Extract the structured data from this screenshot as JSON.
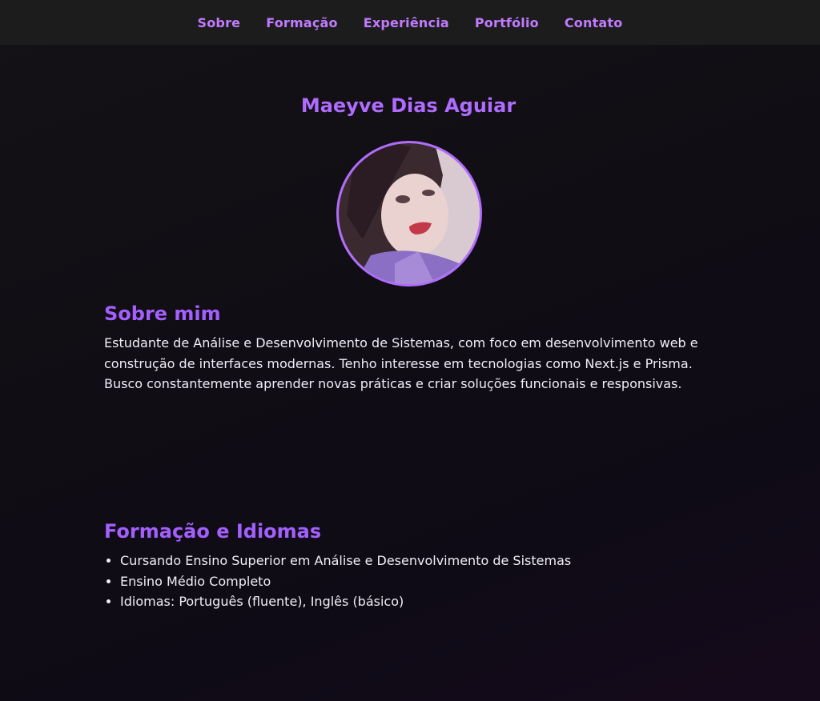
{
  "nav": {
    "items": [
      {
        "label": "Sobre"
      },
      {
        "label": "Formação"
      },
      {
        "label": "Experiência"
      },
      {
        "label": "Portfólio"
      },
      {
        "label": "Contato"
      }
    ]
  },
  "profile": {
    "name": "Maeyve Dias Aguiar"
  },
  "about": {
    "heading": "Sobre mim",
    "text": "Estudante de Análise e Desenvolvimento de Sistemas, com foco em desenvolvimento web e construção de interfaces modernas. Tenho interesse em tecnologias como Next.js e Prisma. Busco constantemente aprender novas práticas e criar soluções funcionais e responsivas."
  },
  "education": {
    "heading": "Formação e Idiomas",
    "items": [
      "Cursando Ensino Superior em Análise e Desenvolvimento de Sistemas",
      "Ensino Médio Completo",
      "Idiomas: Português (fluente), Inglês (básico)"
    ]
  },
  "colors": {
    "accent": "#b06bff",
    "nav_background": "#1c1c1c",
    "page_background": "#121015"
  }
}
